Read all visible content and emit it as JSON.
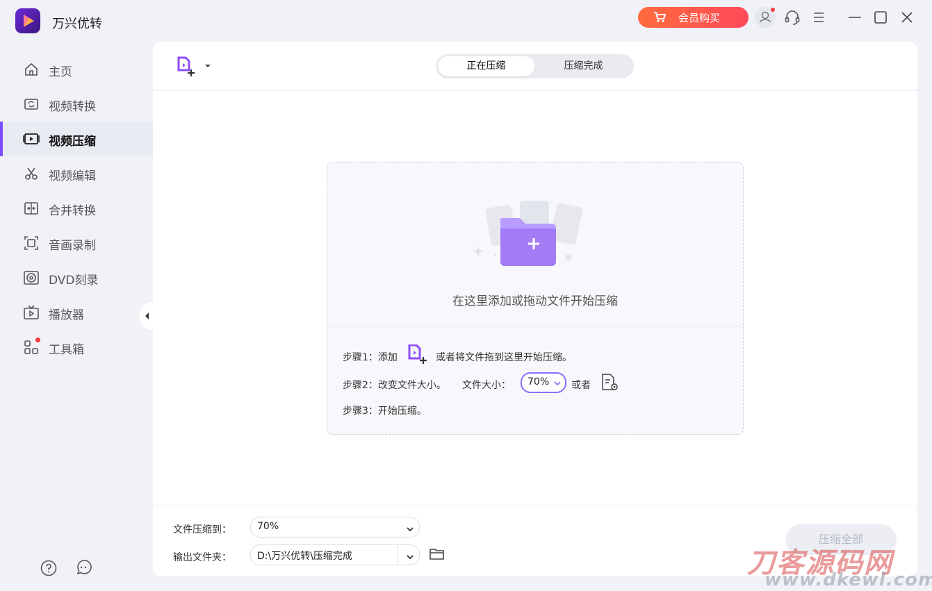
{
  "app": {
    "title": "万兴优转"
  },
  "titlebar": {
    "vip_label": "会员购买"
  },
  "sidebar": {
    "items": [
      {
        "label": "主页",
        "icon": "home-icon"
      },
      {
        "label": "视频转换",
        "icon": "video-convert-icon"
      },
      {
        "label": "视频压缩",
        "icon": "video-compress-icon",
        "active": true
      },
      {
        "label": "视频编辑",
        "icon": "scissors-icon"
      },
      {
        "label": "合并转换",
        "icon": "merge-icon"
      },
      {
        "label": "音画录制",
        "icon": "screen-record-icon"
      },
      {
        "label": "DVD刻录",
        "icon": "disc-icon"
      },
      {
        "label": "播放器",
        "icon": "tv-player-icon"
      },
      {
        "label": "工具箱",
        "icon": "toolbox-icon",
        "badge": true
      }
    ]
  },
  "tabs": [
    {
      "label": "正在压缩",
      "active": true
    },
    {
      "label": "压缩完成",
      "active": false
    }
  ],
  "dropzone": {
    "hint": "在这里添加或拖动文件开始压缩",
    "step1_prefix": "步骤1：添加",
    "step1_suffix": "或者将文件拖到这里开始压缩。",
    "step2_prefix": "步骤2：改变文件大小。",
    "step2_size_label": "文件大小：",
    "step2_size_value": "70%",
    "step2_or": "或者",
    "step3": "步骤3：开始压缩。"
  },
  "footer": {
    "compress_to_label": "文件压缩到：",
    "compress_to_value": "70%",
    "output_folder_label": "输出文件夹：",
    "output_folder_value": "D:\\万兴优转\\压缩完成",
    "compress_all_label": "压缩全部"
  },
  "watermark": {
    "main": "刀客源码网",
    "url": "www.dkewl.com"
  },
  "colors": {
    "accent": "#7a4dff",
    "vip_gradient_start": "#ff6b3d",
    "vip_gradient_end": "#ff4a5a",
    "badge_red": "#ff3b3b"
  }
}
